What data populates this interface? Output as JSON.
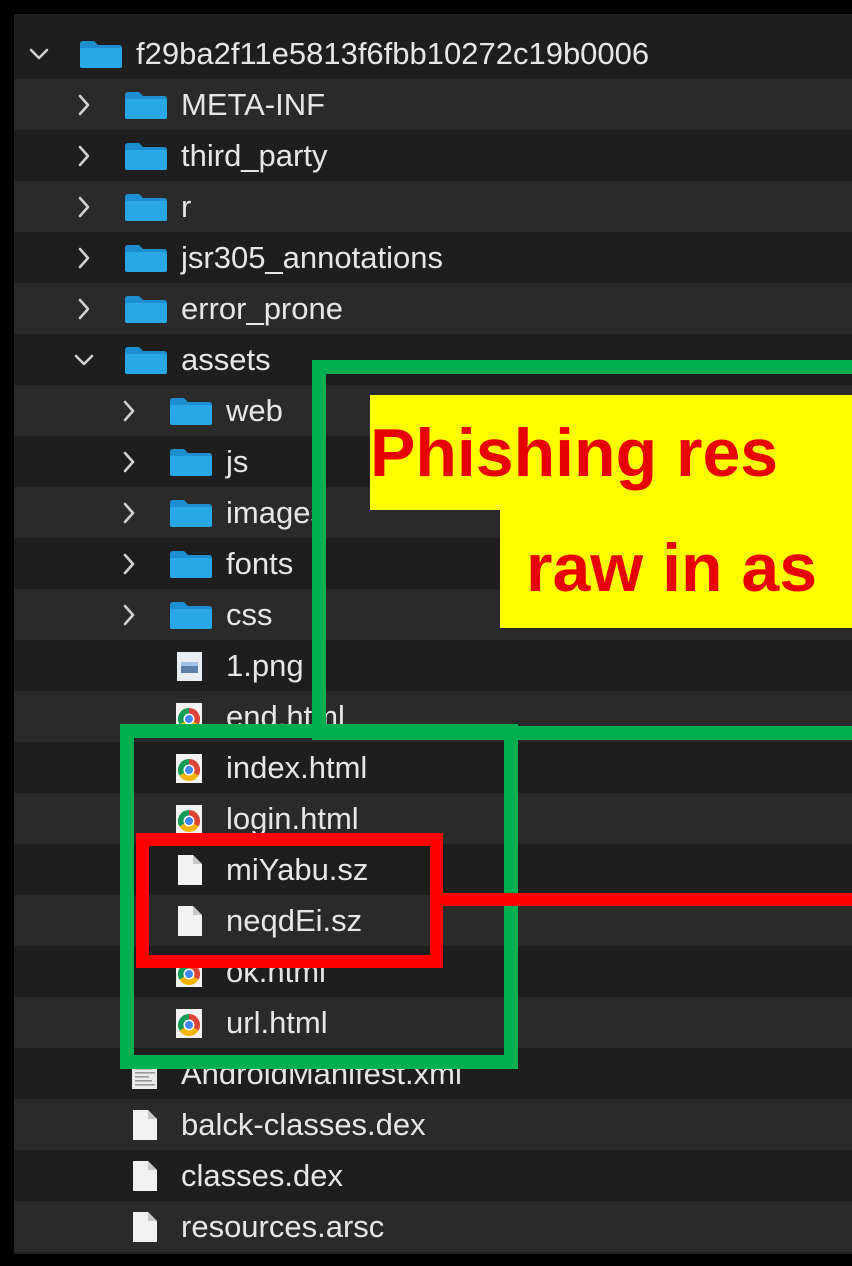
{
  "tree": {
    "root": {
      "label": "f29ba2f11e5813f6fbb10272c19b0006",
      "expanded": true
    },
    "items": [
      {
        "label": "META-INF",
        "type": "folder",
        "expanded": false,
        "level": 1
      },
      {
        "label": "third_party",
        "type": "folder",
        "expanded": false,
        "level": 1
      },
      {
        "label": "r",
        "type": "folder",
        "expanded": false,
        "level": 1
      },
      {
        "label": "jsr305_annotations",
        "type": "folder",
        "expanded": false,
        "level": 1
      },
      {
        "label": "error_prone",
        "type": "folder",
        "expanded": false,
        "level": 1
      },
      {
        "label": "assets",
        "type": "folder",
        "expanded": true,
        "level": 1
      },
      {
        "label": "web",
        "type": "folder",
        "expanded": false,
        "level": 2
      },
      {
        "label": "js",
        "type": "folder",
        "expanded": false,
        "level": 2
      },
      {
        "label": "images",
        "type": "folder",
        "expanded": false,
        "level": 2
      },
      {
        "label": "fonts",
        "type": "folder",
        "expanded": false,
        "level": 2
      },
      {
        "label": "css",
        "type": "folder",
        "expanded": false,
        "level": 2
      },
      {
        "label": "1.png",
        "type": "image-file",
        "level": 2
      },
      {
        "label": "end.html",
        "type": "html-file",
        "level": 2
      },
      {
        "label": "index.html",
        "type": "html-file",
        "level": 2
      },
      {
        "label": "login.html",
        "type": "html-file",
        "level": 2
      },
      {
        "label": "miYabu.sz",
        "type": "file",
        "level": 2
      },
      {
        "label": "neqdEi.sz",
        "type": "file",
        "level": 2
      },
      {
        "label": "ok.html",
        "type": "html-file",
        "level": 2
      },
      {
        "label": "url.html",
        "type": "html-file",
        "level": 2
      },
      {
        "label": "AndroidManifest.xml",
        "type": "xml-file",
        "level": 1
      },
      {
        "label": "balck-classes.dex",
        "type": "file",
        "level": 1
      },
      {
        "label": "classes.dex",
        "type": "file",
        "level": 1
      },
      {
        "label": "resources.arsc",
        "type": "file",
        "level": 1
      }
    ]
  },
  "callout": {
    "line1": "Phishing res",
    "line2": "raw in as"
  },
  "colors": {
    "background": "#1e1e1e",
    "row_alt": "#2a2a2a",
    "text": "#e6e6e6",
    "folder": "#29a8e6",
    "green_box": "#00b050",
    "red_box": "#ff0000",
    "callout_fill": "#ffff00",
    "callout_text": "#e60000"
  },
  "icons": {
    "chevron_expanded": "chevron-down-icon",
    "chevron_collapsed": "chevron-right-icon",
    "folder": "folder-icon",
    "html-file": "chrome-html-icon",
    "image-file": "image-file-icon",
    "xml-file": "xml-file-icon",
    "file": "document-icon"
  }
}
